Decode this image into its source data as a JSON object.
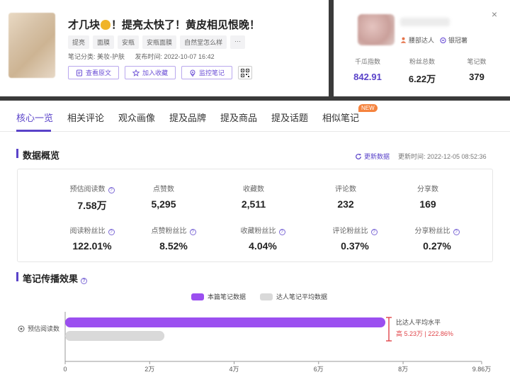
{
  "note": {
    "title_a": "才几块",
    "title_b": "！提亮太快了！黄皮相见恨晚！",
    "tags": [
      "提亮",
      "面膜",
      "安瓶",
      "安瓶面膜",
      "自然堂怎么样",
      "···"
    ],
    "category": "笔记分类: 美妆-护肤",
    "publish_time": "发布时间: 2022-10-07 16:42",
    "buttons": {
      "view": "查看原文",
      "collect": "加入收藏",
      "monitor": "监控笔记"
    }
  },
  "author": {
    "badges": [
      "腰部达人",
      "银冠薯"
    ],
    "stats": [
      {
        "label": "千瓜指数",
        "value": "842.91"
      },
      {
        "label": "粉丝总数",
        "value": "6.22万"
      },
      {
        "label": "笔记数",
        "value": "379"
      }
    ]
  },
  "tabs": [
    "核心一览",
    "相关评论",
    "观众画像",
    "提及品牌",
    "提及商品",
    "提及话题",
    "相似笔记"
  ],
  "new_badge": "NEW",
  "overview": {
    "title": "数据概览",
    "refresh": "更新数据",
    "update_time": "更新时间: 2022-12-05 08:52:36",
    "row1": [
      {
        "label": "预估阅读数",
        "value": "7.58万",
        "help": true
      },
      {
        "label": "点赞数",
        "value": "5,295"
      },
      {
        "label": "收藏数",
        "value": "2,511"
      },
      {
        "label": "评论数",
        "value": "232"
      },
      {
        "label": "分享数",
        "value": "169"
      }
    ],
    "row2": [
      {
        "label": "阅读粉丝比",
        "value": "122.01%"
      },
      {
        "label": "点赞粉丝比",
        "value": "8.52%"
      },
      {
        "label": "收藏粉丝比",
        "value": "4.04%"
      },
      {
        "label": "评论粉丝比",
        "value": "0.37%"
      },
      {
        "label": "分享粉丝比",
        "value": "0.27%"
      }
    ]
  },
  "spread": {
    "title": "笔记传播效果",
    "legend": [
      "本篇笔记数据",
      "达人笔记平均数据"
    ],
    "annotation_line1": "比达人平均水平",
    "annotation_line2": "高 5.23万 | 222.86%"
  },
  "chart_data": {
    "type": "bar",
    "orientation": "horizontal",
    "categories": [
      "预估阅读数"
    ],
    "series": [
      {
        "name": "本篇笔记数据",
        "values": [
          75800
        ]
      },
      {
        "name": "达人笔记平均数据",
        "values": [
          23500
        ]
      }
    ],
    "xticks": [
      "0",
      "2万",
      "4万",
      "6万",
      "8万",
      "9.86万"
    ],
    "xlim": [
      0,
      98600
    ],
    "colors": {
      "note": "#9b4ff0",
      "avg": "#d9d9d9",
      "accent": "#5a43c9",
      "annotation": "#e0454a"
    }
  }
}
